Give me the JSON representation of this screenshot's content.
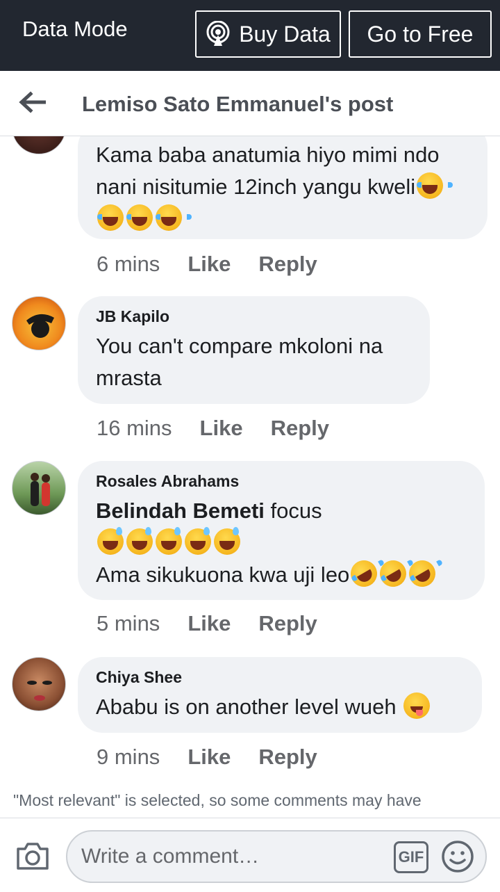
{
  "topbar": {
    "mode_label": "Data Mode",
    "buy_label": "Buy Data",
    "free_label": "Go to Free"
  },
  "header": {
    "title": "Lemiso Sato Emmanuel's post"
  },
  "comments": [
    {
      "author": "",
      "text": "Kama baba anatumia hiyo mimi ndo nani nisitumie 12inch yangu kweli",
      "emojis": [
        "face-with-tears-of-joy",
        "face-with-tears-of-joy",
        "face-with-tears-of-joy",
        "face-with-tears-of-joy"
      ],
      "time": "6 mins"
    },
    {
      "author": "JB Kapilo",
      "text": "You can't compare mkoloni na mrasta",
      "time": "16 mins"
    },
    {
      "author": "Rosales Abrahams",
      "mention": "Belindah Bemeti",
      "text_after_mention": " focus",
      "line2": "Ama sikukuona kwa uji leo",
      "emojis_line1": [
        "grinning-face-with-sweat",
        "grinning-face-with-sweat",
        "grinning-face-with-sweat",
        "grinning-face-with-sweat",
        "grinning-face-with-sweat"
      ],
      "emojis_line2": [
        "rolling-on-floor-laughing",
        "rolling-on-floor-laughing",
        "rolling-on-floor-laughing"
      ],
      "time": "5 mins"
    },
    {
      "author": "Chiya Shee",
      "text": "Ababu is  on another level wueh ",
      "emojis": [
        "face-savoring-food"
      ],
      "time": "9 mins"
    }
  ],
  "actions": {
    "like": "Like",
    "reply": "Reply"
  },
  "notice": "\"Most relevant\" is selected, so some comments may have",
  "composer": {
    "placeholder": "Write a comment…",
    "gif_label": "GIF"
  }
}
